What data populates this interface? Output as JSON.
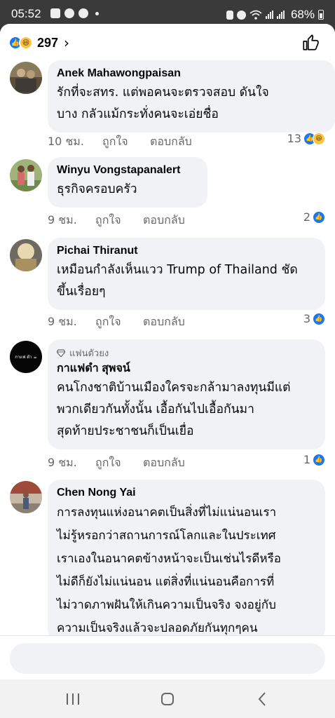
{
  "status_bar": {
    "time": "05:52",
    "battery": "68%"
  },
  "header": {
    "reaction_count": "297",
    "reaction_icons": [
      "like-icon",
      "haha-icon"
    ]
  },
  "comments": [
    {
      "author": "Anek Mahawongpaisan",
      "text_lines": [
        "รักที่จะสทร. แต่พอคนจะตรวจสอบ ดันใจ",
        "บาง กลัวแม้กระทั่งคนจะเอ่ยชื่อ"
      ],
      "time": "10 ชม.",
      "reactions": "13",
      "reaction_types": [
        "like",
        "haha"
      ]
    },
    {
      "author": "Winyu Vongstapanalert",
      "text_lines": [
        "ธุรกิจครอบครัว"
      ],
      "time": "9 ชม.",
      "reactions": "2",
      "reaction_types": [
        "like"
      ]
    },
    {
      "author": "Pichai Thiranut",
      "text_lines": [
        "เหมือนกำลังเห็นแวว Trump of Thailand ชัด",
        "ขึ้นเรื่อยๆ"
      ],
      "time": "9 ชม.",
      "reactions": "3",
      "reaction_types": [
        "like"
      ]
    },
    {
      "badge": "แฟนตัวยง",
      "author": "กาแฟดำ สุพจน์",
      "avatar_text": "กาแฟ ดำ ☕",
      "text_lines": [
        "คนโกงชาติบ้านเมืองใครจะกล้ามาลงทุนมีแต่",
        "พวกเดียวกันทั้งนั้น  เอื้อกันไปเอื้อกันมา",
        "สุดท้ายประชาชนก็เป็นเยื่อ"
      ],
      "time": "9 ชม.",
      "reactions": "1",
      "reaction_types": [
        "like"
      ]
    },
    {
      "author": "Chen Nong Yai",
      "text_lines": [
        "การลงทุนแห่งอนาคตเป็นสิ่งที่ไม่แน่นอนเรา",
        "ไม่รู้หรอกว่าสถานการณ์โลกและในประเทศ",
        "เราเองในอนาคตข้างหน้าจะเป็นเช่นไรดีหรือ",
        "ไม่ดีก็ยังไม่แน่นอน แต่สิ่งที่แน่นอนคือการที่",
        "ไม่วาดภาพฝันให้เกินความเป็นจริง จงอยู่กับ",
        "ความเป็นจริงแล้วจะปลอดภัยกันทุกๆคน"
      ]
    }
  ],
  "actions": {
    "like_label": "ถูกใจ",
    "reply_label": "ตอบกลับ"
  },
  "colors": {
    "facebook_blue": "#1877f2",
    "bubble_gray": "#f0f2f5",
    "meta_gray": "#65676b"
  }
}
